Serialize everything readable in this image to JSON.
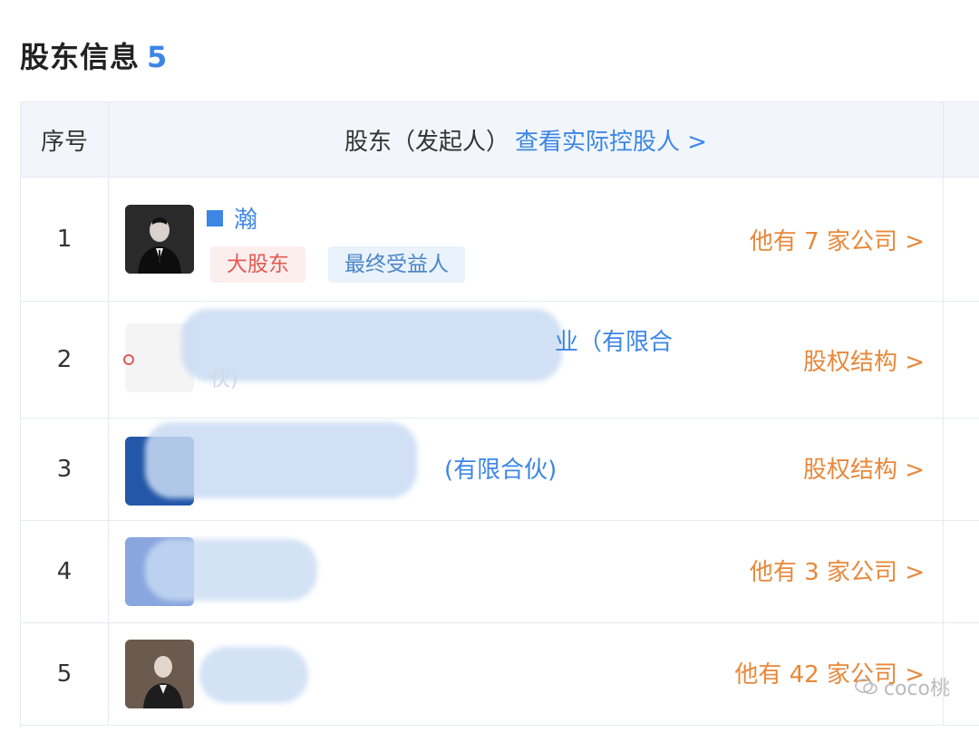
{
  "section": {
    "title": "股东信息",
    "count": "5"
  },
  "header": {
    "col_no": "序号",
    "col_holder": "股东（发起人）",
    "holder_link": "查看实际控股人 >"
  },
  "rows": [
    {
      "no": "1",
      "name": "瀚",
      "tags": [
        "大股东",
        "最终受益人"
      ],
      "action": "他有 7 家公司 >"
    },
    {
      "no": "2",
      "name_visible": "业（有限合",
      "name_tail": "伙)",
      "action": "股权结构 >"
    },
    {
      "no": "3",
      "name_visible": "(有限合伙)",
      "action": "股权结构 >"
    },
    {
      "no": "4",
      "action": "他有 3 家公司 >"
    },
    {
      "no": "5",
      "action": "他有 42 家公司 >"
    }
  ],
  "watermark": {
    "text": "coco桃"
  },
  "colors": {
    "accent": "#3d86e6",
    "action": "#e8883a",
    "tag_red": "#e15b52",
    "tag_blue": "#4a86c8"
  }
}
